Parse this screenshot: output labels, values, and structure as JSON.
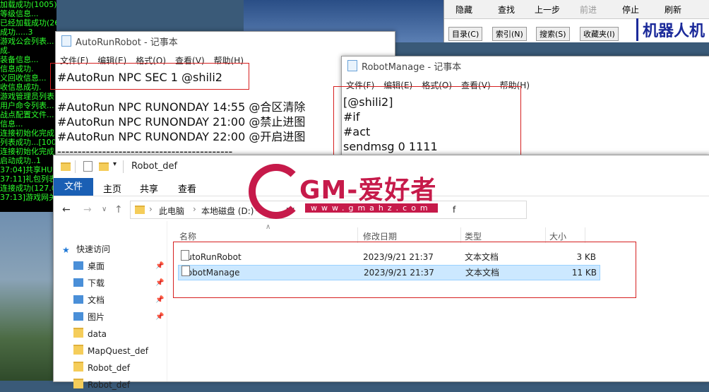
{
  "console_lines": [
    "加载成功(1005).",
    "等级信息...",
    "已经加载成功(260).",
    "成功.....3",
    "游戏公会列表...",
    "成.",
    "装备信息...",
    "信息成功.",
    "义回收信息...",
    "收信息成功.",
    "游戏管理员列表...",
    "用户命令列表...",
    "战点配置文件...",
    "信息...",
    "连接初始化完成.",
    "列表成功...[100]",
    "连接初始化完成.",
    "启动成功..1",
    "37:04]共享HUM",
    "37:11]礼包列表",
    "连接成功(127.0",
    "37:13]游戏网关"
  ],
  "help": {
    "toolbar": [
      "隐藏",
      "查找",
      "上一步",
      "前进",
      "停止",
      "刷新"
    ],
    "tabs": [
      "目录(C)",
      "索引(N)",
      "搜索(S)",
      "收藏夹(I)"
    ],
    "title_partial": "机器人机"
  },
  "notepad1": {
    "title": "AutoRunRobot - 记事本",
    "menu": [
      "文件(F)",
      "编辑(E)",
      "格式(O)",
      "查看(V)",
      "帮助(H)"
    ],
    "lines": [
      "#AutoRun NPC SEC 1 @shili2",
      "",
      "#AutoRun NPC RUNONDAY 14:55 @合区清除",
      "#AutoRun NPC RUNONDAY 21:00 @禁止进图",
      "#AutoRun NPC RUNONDAY 22:00 @开启进图",
      "-------------------------------------------"
    ]
  },
  "notepad2": {
    "title": "RobotManage - 记事本",
    "menu": [
      "文件(F)",
      "编辑(E)",
      "格式(O)",
      "查看(V)",
      "帮助(H)"
    ],
    "lines": [
      "[@shili2]",
      "#if",
      "#act",
      "sendmsg 0 1111"
    ]
  },
  "explorer": {
    "title": "Robot_def",
    "ribbon": {
      "file": "文件",
      "home": "主页",
      "share": "共享",
      "view": "查看"
    },
    "address": [
      "此电脑",
      "本地磁盘 (D:)",
      "rv",
      "f"
    ],
    "columns": {
      "name": "名称",
      "modified": "修改日期",
      "type": "类型",
      "size": "大小"
    },
    "nav": [
      {
        "label": "快速访问",
        "icon": "star-icon"
      },
      {
        "label": "桌面",
        "icon": "desktop-icon",
        "pinned": true
      },
      {
        "label": "下载",
        "icon": "download-icon",
        "pinned": true
      },
      {
        "label": "文档",
        "icon": "document-icon",
        "pinned": true
      },
      {
        "label": "图片",
        "icon": "picture-icon",
        "pinned": true
      },
      {
        "label": "data",
        "icon": "folder-icon"
      },
      {
        "label": "MapQuest_def",
        "icon": "folder-icon"
      },
      {
        "label": "Robot_def",
        "icon": "folder-icon"
      },
      {
        "label": "Robot_def",
        "icon": "folder-icon"
      }
    ],
    "files": [
      {
        "name": "AutoRunRobot",
        "modified": "2023/9/21 21:37",
        "type": "文本文档",
        "size": "3 KB",
        "selected": false
      },
      {
        "name": "RobotManage",
        "modified": "2023/9/21 21:37",
        "type": "文本文档",
        "size": "11 KB",
        "selected": true
      }
    ]
  },
  "watermark": {
    "brand": "GM-爱好者",
    "url": "www.gmahz.com"
  },
  "colors": {
    "annotation_red": "#d62020",
    "watermark_red": "#c61a4a",
    "ribbon_blue": "#1a5fb4"
  }
}
